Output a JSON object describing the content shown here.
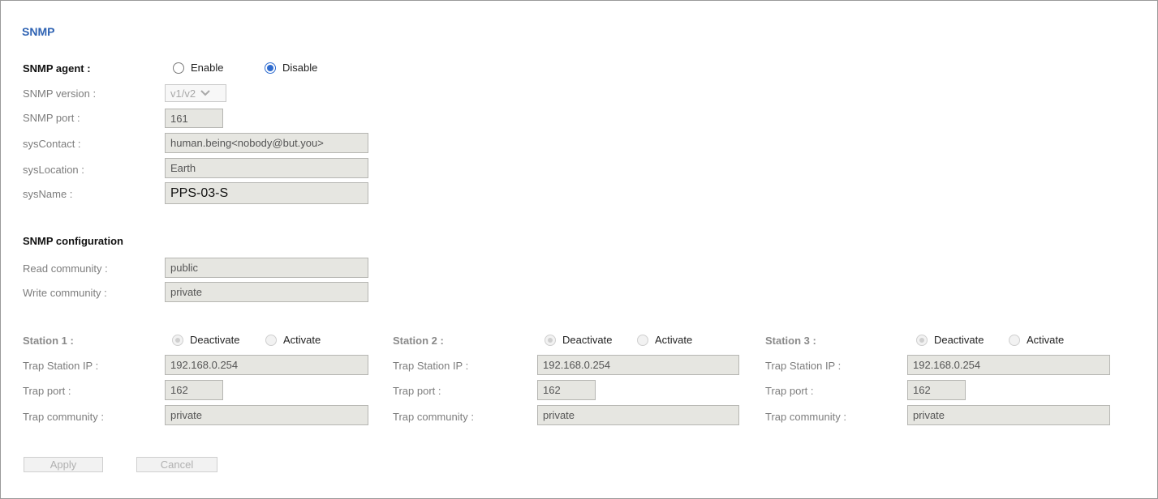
{
  "page": {
    "title": "SNMP"
  },
  "agent": {
    "label": "SNMP agent :",
    "enable_label": "Enable",
    "disable_label": "Disable",
    "selected": "Disable"
  },
  "version": {
    "label": "SNMP version :",
    "value": "v1/v2"
  },
  "port": {
    "label": "SNMP port :",
    "value": "161"
  },
  "sys_contact": {
    "label": "sysContact :",
    "value": "human.being<nobody@but.you>"
  },
  "sys_location": {
    "label": "sysLocation :",
    "value": "Earth"
  },
  "sys_name": {
    "label": "sysName :",
    "value": "PPS-03-S"
  },
  "config": {
    "title": "SNMP configuration",
    "read_label": "Read community :",
    "read_value": "public",
    "write_label": "Write community :",
    "write_value": "private"
  },
  "stations": [
    {
      "label": "Station 1 :",
      "deactivate_label": "Deactivate",
      "activate_label": "Activate",
      "selected": "Deactivate",
      "ip_label": "Trap Station IP :",
      "ip_value": "192.168.0.254",
      "port_label": "Trap port :",
      "port_value": "162",
      "community_label": "Trap community :",
      "community_value": "private"
    },
    {
      "label": "Station 2 :",
      "deactivate_label": "Deactivate",
      "activate_label": "Activate",
      "selected": "Deactivate",
      "ip_label": "Trap Station IP :",
      "ip_value": "192.168.0.254",
      "port_label": "Trap port :",
      "port_value": "162",
      "community_label": "Trap community :",
      "community_value": "private"
    },
    {
      "label": "Station 3 :",
      "deactivate_label": "Deactivate",
      "activate_label": "Activate",
      "selected": "Deactivate",
      "ip_label": "Trap Station IP :",
      "ip_value": "192.168.0.254",
      "port_label": "Trap port :",
      "port_value": "162",
      "community_label": "Trap community :",
      "community_value": "private"
    }
  ],
  "buttons": {
    "apply": "Apply",
    "cancel": "Cancel"
  },
  "colors": {
    "title": "#2f63b3",
    "radio_selected": "#2f6ccf",
    "field_bg": "#e6e6e1"
  },
  "icons": {
    "select_arrow": "chevron-down-icon"
  }
}
